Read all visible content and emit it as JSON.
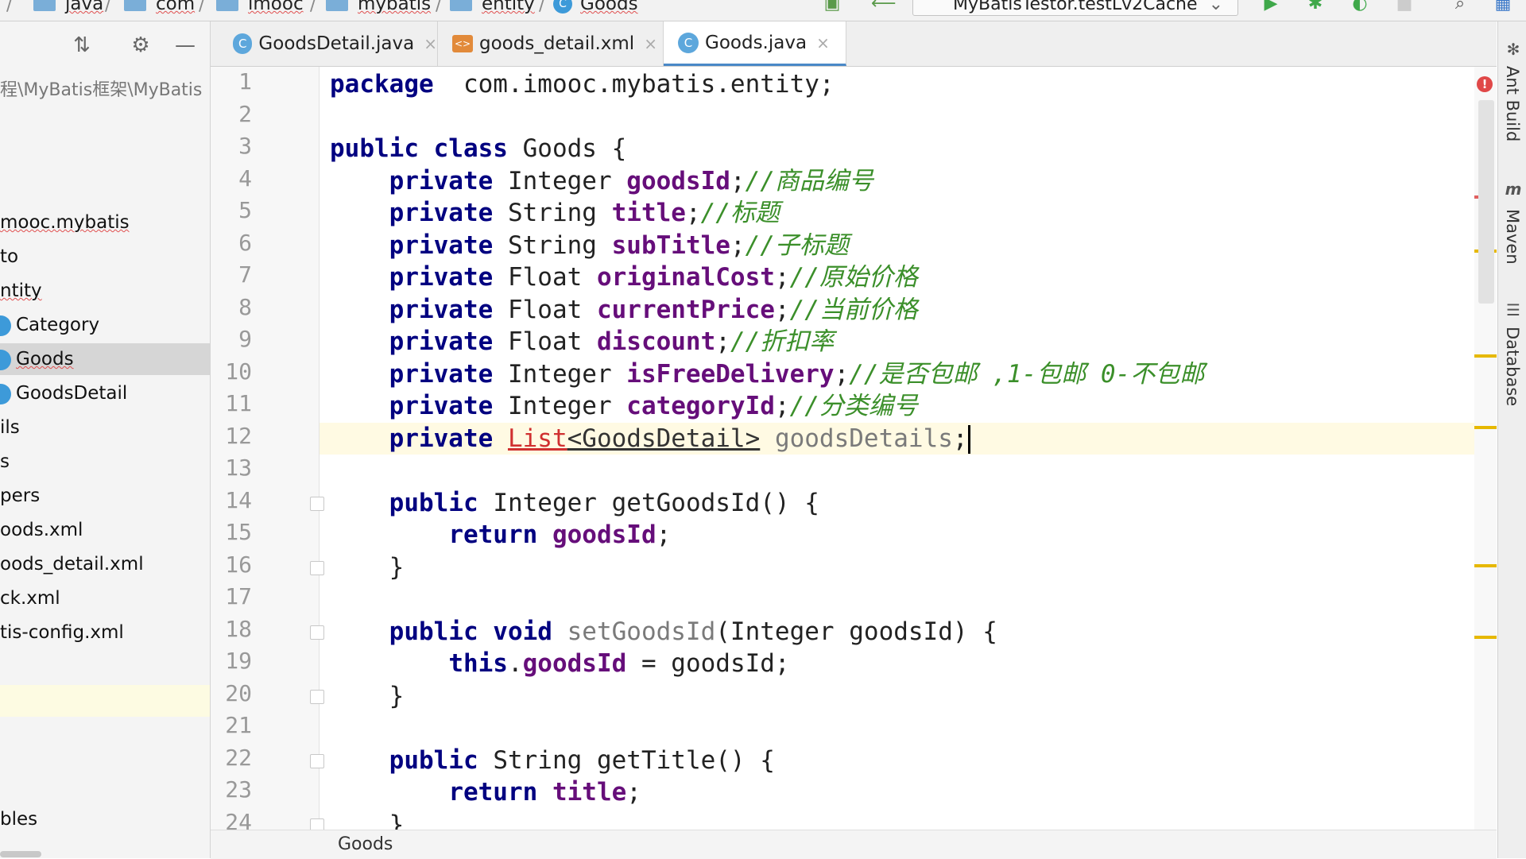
{
  "breadcrumbs": [
    "java",
    "com",
    "imooc",
    "mybatis",
    "entity",
    "Goods"
  ],
  "run_config": "MyBatisTestor.testLv2Cache",
  "project_panel": {
    "path": "程\\MyBatis框架\\MyBatis",
    "items": [
      {
        "label": "mooc.mybatis",
        "state": ""
      },
      {
        "label": "to",
        "state": ""
      },
      {
        "label": "ntity",
        "state": ""
      },
      {
        "label": "Category",
        "state": ""
      },
      {
        "label": "Goods",
        "state": "selected"
      },
      {
        "label": "GoodsDetail",
        "state": ""
      },
      {
        "label": "ils",
        "state": ""
      },
      {
        "label": "s",
        "state": ""
      },
      {
        "label": "pers",
        "state": ""
      },
      {
        "label": "oods.xml",
        "state": ""
      },
      {
        "label": "oods_detail.xml",
        "state": ""
      },
      {
        "label": "ck.xml",
        "state": ""
      },
      {
        "label": "tis-config.xml",
        "state": ""
      },
      {
        "label": "",
        "state": "highlight"
      },
      {
        "label": "bles",
        "state": ""
      }
    ]
  },
  "tabs": [
    {
      "label": "GoodsDetail.java",
      "icon": "class-icon",
      "active": false
    },
    {
      "label": "goods_detail.xml",
      "icon": "xml-icon",
      "active": false
    },
    {
      "label": "Goods.java",
      "icon": "class-icon",
      "active": true
    }
  ],
  "editor": {
    "current_line": 12,
    "lines": [
      {
        "n": "1",
        "tokens": [
          [
            "kw",
            "package"
          ],
          [
            "",
            "  com.imooc.mybatis.entity;"
          ]
        ]
      },
      {
        "n": "2",
        "tokens": []
      },
      {
        "n": "3",
        "tokens": [
          [
            "kw",
            "public class "
          ],
          [
            "",
            "Goods {"
          ]
        ]
      },
      {
        "n": "4",
        "tokens": [
          [
            "",
            "    "
          ],
          [
            "kw",
            "private "
          ],
          [
            "",
            "Integer "
          ],
          [
            "fld",
            "goodsId"
          ],
          [
            "",
            ";"
          ],
          [
            "cm",
            "//商品编号"
          ]
        ]
      },
      {
        "n": "5",
        "tokens": [
          [
            "",
            "    "
          ],
          [
            "kw",
            "private "
          ],
          [
            "",
            "String "
          ],
          [
            "fld",
            "title"
          ],
          [
            "",
            ";"
          ],
          [
            "cm",
            "//标题"
          ]
        ]
      },
      {
        "n": "6",
        "tokens": [
          [
            "",
            "    "
          ],
          [
            "kw",
            "private "
          ],
          [
            "",
            "String "
          ],
          [
            "fld",
            "subTitle"
          ],
          [
            "",
            ";"
          ],
          [
            "cm",
            "//子标题"
          ]
        ]
      },
      {
        "n": "7",
        "tokens": [
          [
            "",
            "    "
          ],
          [
            "kw",
            "private "
          ],
          [
            "",
            "Float "
          ],
          [
            "fld",
            "originalCost"
          ],
          [
            "",
            ";"
          ],
          [
            "cm",
            "//原始价格"
          ]
        ]
      },
      {
        "n": "8",
        "tokens": [
          [
            "",
            "    "
          ],
          [
            "kw",
            "private "
          ],
          [
            "",
            "Float "
          ],
          [
            "fld",
            "currentPrice"
          ],
          [
            "",
            ";"
          ],
          [
            "cm",
            "//当前价格"
          ]
        ]
      },
      {
        "n": "9",
        "tokens": [
          [
            "",
            "    "
          ],
          [
            "kw",
            "private "
          ],
          [
            "",
            "Float "
          ],
          [
            "fld",
            "discount"
          ],
          [
            "",
            ";"
          ],
          [
            "cm",
            "//折扣率"
          ]
        ]
      },
      {
        "n": "10",
        "tokens": [
          [
            "",
            "    "
          ],
          [
            "kw",
            "private "
          ],
          [
            "",
            "Integer "
          ],
          [
            "fld",
            "isFreeDelivery"
          ],
          [
            "",
            ";"
          ],
          [
            "cm",
            "//是否包邮 ,1-包邮 0-不包邮"
          ]
        ]
      },
      {
        "n": "11",
        "tokens": [
          [
            "",
            "    "
          ],
          [
            "kw",
            "private "
          ],
          [
            "",
            "Integer "
          ],
          [
            "fld",
            "categoryId"
          ],
          [
            "",
            ";"
          ],
          [
            "cm",
            "//分类编号"
          ]
        ]
      },
      {
        "n": "12",
        "tokens": [
          [
            "",
            "    "
          ],
          [
            "kw",
            "private "
          ],
          [
            "err",
            "List"
          ],
          [
            "ty",
            "<GoodsDetail>"
          ],
          [
            "",
            " "
          ],
          [
            "mt",
            "goodsDetails"
          ],
          [
            "",
            ";"
          ],
          [
            "cursor",
            ""
          ]
        ]
      },
      {
        "n": "13",
        "tokens": []
      },
      {
        "n": "14",
        "tokens": [
          [
            "",
            "    "
          ],
          [
            "kw",
            "public "
          ],
          [
            "",
            "Integer getGoodsId() {"
          ]
        ]
      },
      {
        "n": "15",
        "tokens": [
          [
            "",
            "        "
          ],
          [
            "kw",
            "return "
          ],
          [
            "fld",
            "goodsId"
          ],
          [
            "",
            ";"
          ]
        ]
      },
      {
        "n": "16",
        "tokens": [
          [
            "",
            "    }"
          ]
        ]
      },
      {
        "n": "17",
        "tokens": []
      },
      {
        "n": "18",
        "tokens": [
          [
            "",
            "    "
          ],
          [
            "kw",
            "public void "
          ],
          [
            "mt",
            "setGoodsId"
          ],
          [
            "",
            "(Integer goodsId) {"
          ]
        ]
      },
      {
        "n": "19",
        "tokens": [
          [
            "",
            "        "
          ],
          [
            "kw",
            "this"
          ],
          [
            "",
            "."
          ],
          [
            "fld",
            "goodsId"
          ],
          [
            "",
            " = goodsId;"
          ]
        ]
      },
      {
        "n": "20",
        "tokens": [
          [
            "",
            "    }"
          ]
        ]
      },
      {
        "n": "21",
        "tokens": []
      },
      {
        "n": "22",
        "tokens": [
          [
            "",
            "    "
          ],
          [
            "kw",
            "public "
          ],
          [
            "",
            "String getTitle() {"
          ]
        ]
      },
      {
        "n": "23",
        "tokens": [
          [
            "",
            "        "
          ],
          [
            "kw",
            "return "
          ],
          [
            "fld",
            "title"
          ],
          [
            "",
            ";"
          ]
        ]
      },
      {
        "n": "24",
        "tokens": [
          [
            "",
            "    }"
          ]
        ]
      }
    ]
  },
  "footer_breadcrumb": "Goods",
  "right_tools": [
    "Ant Build",
    "Maven",
    "Database"
  ],
  "colors": {
    "keyword": "#000080",
    "field": "#660e7a",
    "comment": "#3b8f2a",
    "error": "#d03030",
    "accent": "#4a88c7",
    "current_line": "#fffae3"
  }
}
